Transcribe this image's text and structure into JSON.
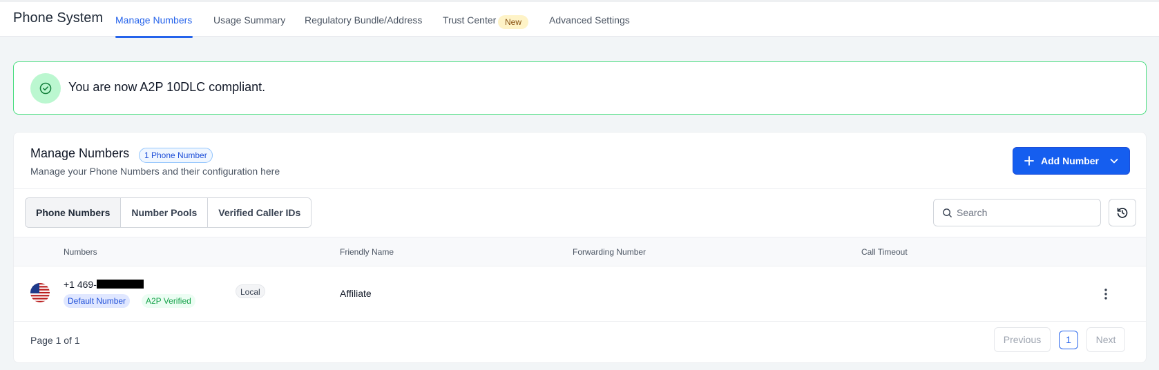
{
  "app": {
    "title": "Phone System"
  },
  "tabs": [
    {
      "label": "Manage Numbers",
      "active": true
    },
    {
      "label": "Usage Summary"
    },
    {
      "label": "Regulatory Bundle/Address"
    },
    {
      "label": "Trust Center",
      "badge": "New"
    },
    {
      "label": "Advanced Settings"
    }
  ],
  "alert": {
    "text": "You are now A2P 10DLC compliant.",
    "icon": "check-circle-icon",
    "color": "#22c55e"
  },
  "card": {
    "title": "Manage Numbers",
    "count_badge": "1 Phone Number",
    "subtitle": "Manage your Phone Numbers and their configuration here",
    "add_button": "Add Number"
  },
  "segments": [
    "Phone Numbers",
    "Number Pools",
    "Verified Caller IDs"
  ],
  "search": {
    "placeholder": "Search"
  },
  "table": {
    "columns": [
      "Numbers",
      "Friendly Name",
      "Forwarding Number",
      "Call Timeout"
    ],
    "rows": [
      {
        "number": "+1 469-",
        "badges": [
          "Default Number",
          "A2P Verified"
        ],
        "type": "Local",
        "friendly_name": "Affiliate",
        "forwarding_number": "",
        "call_timeout": "",
        "flag": "us-flag-icon"
      }
    ]
  },
  "pagination": {
    "text": "Page 1 of 1",
    "previous": "Previous",
    "current": "1",
    "next": "Next"
  },
  "colors": {
    "accent": "#155eef",
    "success": "#22c55e"
  }
}
